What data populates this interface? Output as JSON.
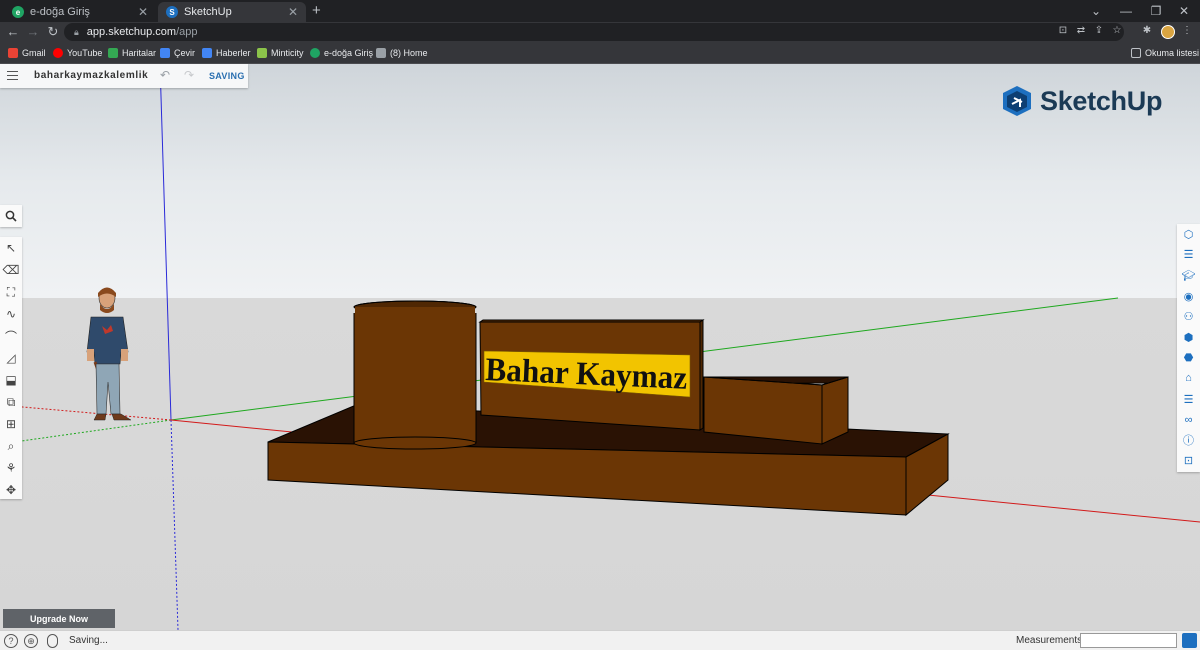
{
  "browser": {
    "tabs": [
      {
        "title": "e-doğa Giriş",
        "active": false,
        "favicon_color": "#1fa463"
      },
      {
        "title": "SketchUp",
        "active": true,
        "favicon_color": "#1d6fbf"
      }
    ],
    "url": {
      "host": "app.sketchup.com",
      "path": "/app"
    },
    "bookmarks": [
      {
        "label": "Gmail",
        "icon": "gmail-icon",
        "color": "#ea4335"
      },
      {
        "label": "YouTube",
        "icon": "youtube-icon",
        "color": "#ff0000"
      },
      {
        "label": "Haritalar",
        "icon": "maps-icon",
        "color": "#34a853"
      },
      {
        "label": "Çevir",
        "icon": "translate-icon",
        "color": "#4285f4"
      },
      {
        "label": "Haberler",
        "icon": "news-icon",
        "color": "#4285f4"
      },
      {
        "label": "Minticity",
        "icon": "minticity-icon",
        "color": "#8bc34a"
      },
      {
        "label": "e-doğa Giriş",
        "icon": "edoga-icon",
        "color": "#1fa463"
      },
      {
        "label": "(8) Home",
        "icon": "home-icon",
        "color": "#9aa0a6"
      }
    ],
    "reading_list": "Okuma listesi"
  },
  "app": {
    "file_name": "baharkaymazkalemlik",
    "save_status": "SAVING",
    "logo_text": "SketchUp",
    "upgrade_label": "Upgrade Now",
    "model_text": "Bahar Kaymaz",
    "status_text": "Saving...",
    "measurements_label": "Measurements",
    "colors": {
      "wood": "#6b3605",
      "sign": "#f2c400",
      "accent": "#1d6fbf"
    }
  }
}
